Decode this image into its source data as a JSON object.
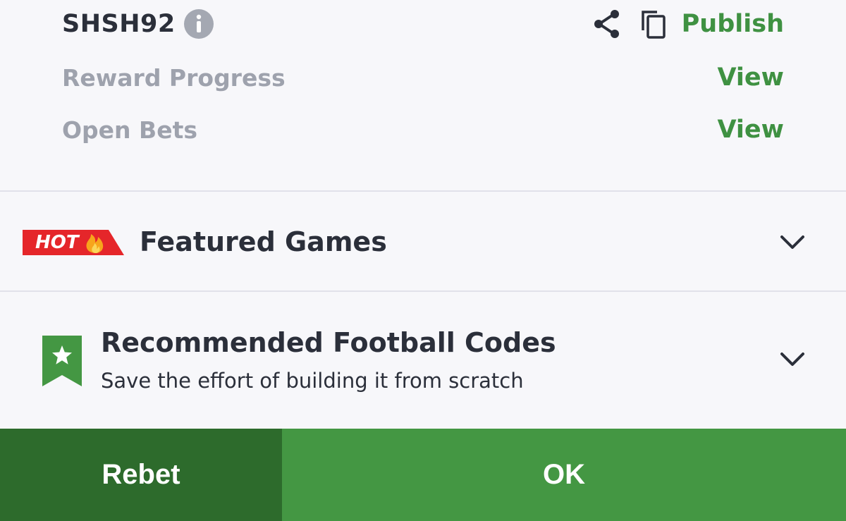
{
  "booking": {
    "code": "SHSH92",
    "info_icon": "info-icon",
    "share_icon": "share-icon",
    "copy_icon": "copy-icon",
    "publish_label": "Publish"
  },
  "rows": [
    {
      "label": "Reward Progress",
      "action": "View"
    },
    {
      "label": "Open Bets",
      "action": "View"
    }
  ],
  "featured": {
    "badge_text": "HOT",
    "badge_icon": "flame-icon",
    "title": "Featured Games",
    "chevron_icon": "chevron-down-icon"
  },
  "recommended": {
    "icon": "star-bookmark-icon",
    "title": "Recommended Football Codes",
    "subtitle": "Save the effort of building it from scratch",
    "chevron_icon": "chevron-down-icon"
  },
  "buttons": {
    "rebet": "Rebet",
    "ok": "OK"
  },
  "colors": {
    "accent_green": "#3f9142",
    "rebet_bg": "#2d6b2c",
    "ok_bg": "#449743",
    "hot_red": "#e5262a",
    "text_dark": "#2b2f3a",
    "text_muted": "#9ea2ad"
  }
}
